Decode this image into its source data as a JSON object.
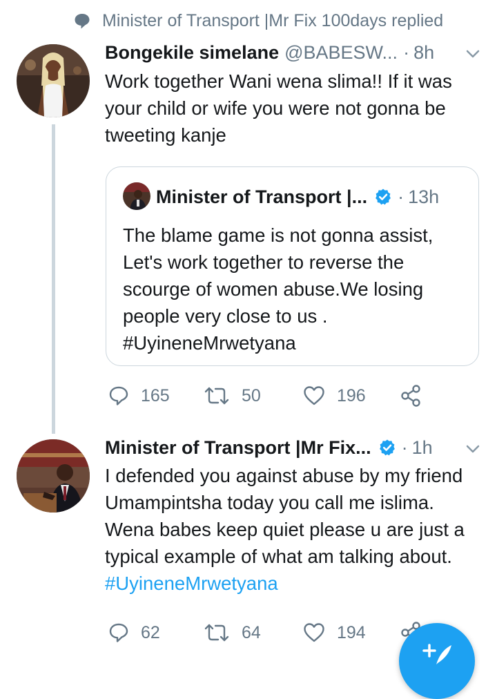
{
  "context": {
    "text": "Minister of Transport |Mr Fix 100days replied",
    "icon": "speech-bubble-icon"
  },
  "tweet1": {
    "name": "Bongekile simelane",
    "handle": "@BABESW...",
    "dot": "·",
    "time": "8h",
    "text": "Work together Wani wena slima!! If it was your child or wife you were not gonna be tweeting kanje",
    "quote": {
      "name": "Minister of Transport |...",
      "verified": true,
      "dot": "·",
      "time": "13h",
      "text": "The blame game is not gonna assist, Let's work together to reverse the scourge of women abuse.We losing people very close to us . #UyineneMrwetyana"
    },
    "replies": "165",
    "retweets": "50",
    "likes": "196"
  },
  "tweet2": {
    "name": "Minister of Transport |Mr Fix...",
    "verified": true,
    "dot": "·",
    "time": "1h",
    "text_plain": "I defended  you against abuse by my friend Umampintsha today you call me islima. Wena babes  keep quiet please u are just a typical  example  of what am talking about. ",
    "hashtag": "#UyineneMrwetyana",
    "replies": "62",
    "retweets": "64",
    "likes": "194"
  },
  "colors": {
    "accent": "#1da1f2",
    "secondary_text": "#657786",
    "primary_text": "#14171a",
    "border": "#ccd6dd"
  },
  "compose_button": {
    "icon": "compose-plus-feather-icon"
  }
}
